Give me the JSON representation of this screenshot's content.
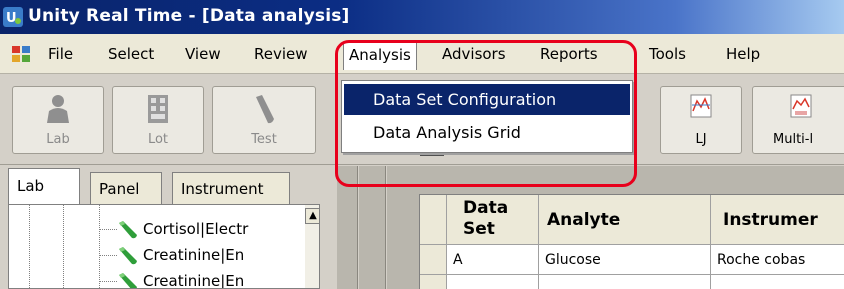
{
  "window": {
    "title": "Unity Real Time - [Data analysis]"
  },
  "menu": {
    "items": [
      "File",
      "Select",
      "View",
      "Review",
      "Analysis",
      "Advisors",
      "Reports",
      "Tools",
      "Help"
    ],
    "open_menu": "Analysis",
    "dropdown": [
      "Data Set Configuration",
      "Data Analysis Grid"
    ],
    "highlighted": "Data Set Configuration"
  },
  "toolbar": {
    "lab": "Lab",
    "lot": "Lot",
    "test": "Test",
    "lj": "LJ",
    "multi": "Multi-l"
  },
  "tabs": [
    "Lab",
    "Panel",
    "Instrument"
  ],
  "tree": {
    "items": [
      "Cortisol|Electr",
      "Creatinine|En",
      "Creatinine|En"
    ]
  },
  "grid": {
    "headers": {
      "dataset_line1": "Data",
      "dataset_line2": "Set",
      "analyte": "Analyte",
      "instrument": "Instrumer"
    },
    "rows": [
      {
        "dataset": "A",
        "analyte": "Glucose",
        "instrument": "Roche cobas"
      }
    ]
  },
  "colors": {
    "titlebar": "#0a246a",
    "highlight": "#0a246a",
    "annotation": "#e8001c"
  }
}
